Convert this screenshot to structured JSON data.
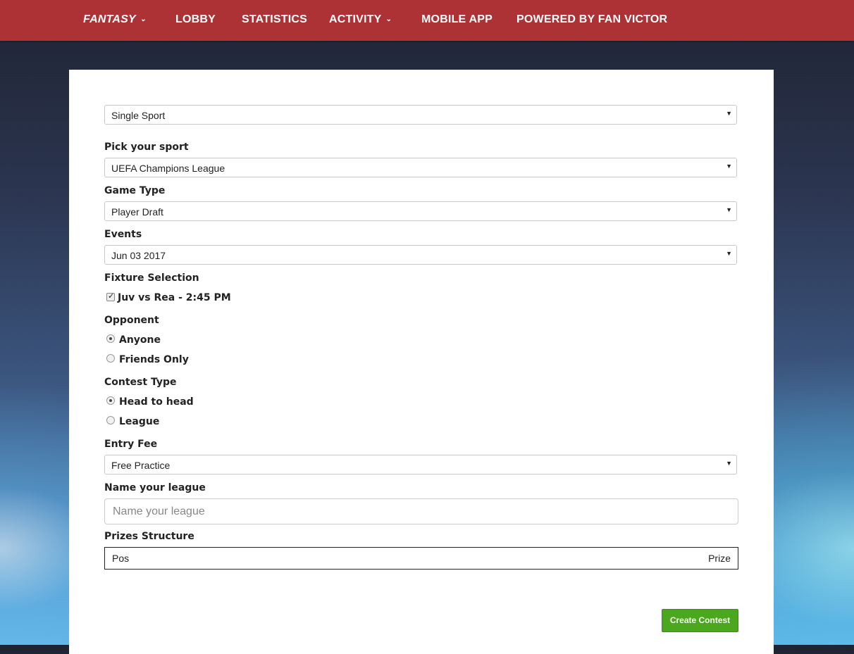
{
  "nav": {
    "fantasy": "FANTASY",
    "lobby": "LOBBY",
    "statistics": "STATISTICS",
    "activity": "ACTIVITY",
    "mobile_app": "MOBILE APP",
    "powered_by": "POWERED BY FAN VICTOR"
  },
  "form": {
    "mode_select": "Single Sport",
    "sport_label": "Pick your sport",
    "sport_value": "UEFA Champions League",
    "game_type_label": "Game Type",
    "game_type_value": "Player Draft",
    "events_label": "Events",
    "events_value": "Jun 03 2017",
    "fixture_label": "Fixture Selection",
    "fixture_item": "Juv vs Rea - 2:45 PM",
    "opponent_label": "Opponent",
    "opponent_anyone": "Anyone",
    "opponent_friends": "Friends Only",
    "contest_type_label": "Contest Type",
    "contest_h2h": "Head to head",
    "contest_league": "League",
    "entry_fee_label": "Entry Fee",
    "entry_fee_value": "Free Practice",
    "league_name_label": "Name your league",
    "league_name_placeholder": "Name your league",
    "league_name_value": "",
    "prizes_label": "Prizes Structure",
    "prizes_pos": "Pos",
    "prizes_prize": "Prize",
    "create_button": "Create Contest"
  },
  "colors": {
    "topbar": "#ad3236",
    "create_button": "#4aa71e"
  }
}
